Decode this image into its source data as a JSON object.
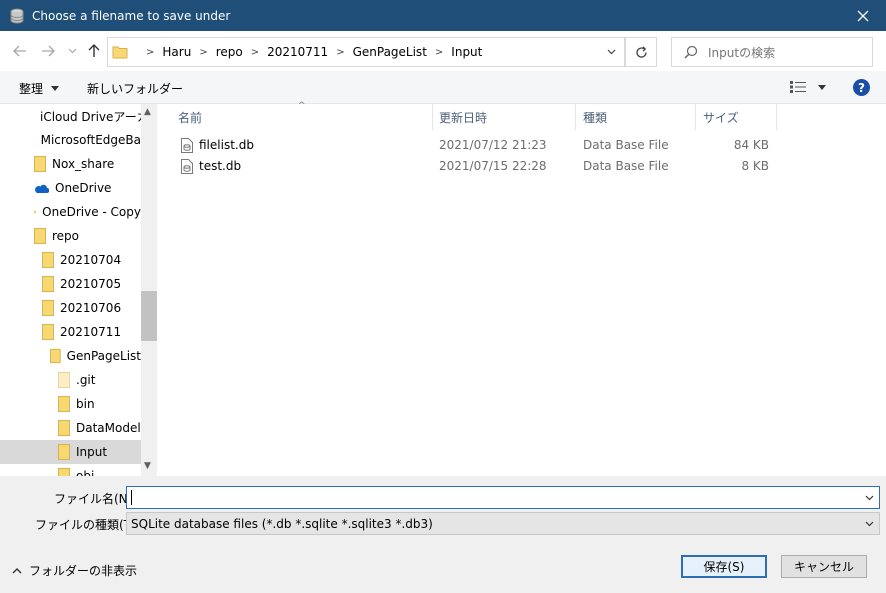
{
  "window": {
    "title": "Choose a filename to save under"
  },
  "address": {
    "crumbs": [
      "Haru",
      "repo",
      "20210711",
      "GenPageList",
      "Input"
    ]
  },
  "search": {
    "placeholder": "Inputの検索"
  },
  "toolbar": {
    "organize": "整理",
    "new_folder": "新しいフォルダー",
    "help": "?"
  },
  "nav": {
    "items": [
      {
        "label": "iCloud Driveアーカ",
        "indent": 0
      },
      {
        "label": "MicrosoftEdgeBa",
        "indent": 0
      },
      {
        "label": "Nox_share",
        "indent": 0
      },
      {
        "label": "OneDrive",
        "indent": 0
      },
      {
        "label": "OneDrive - Copy",
        "indent": 0
      },
      {
        "label": "repo",
        "indent": 0
      },
      {
        "label": "20210704",
        "indent": 1
      },
      {
        "label": "20210705",
        "indent": 1
      },
      {
        "label": "20210706",
        "indent": 1
      },
      {
        "label": "20210711",
        "indent": 1
      },
      {
        "label": "GenPageList",
        "indent": 2
      },
      {
        "label": ".git",
        "indent": 3
      },
      {
        "label": "bin",
        "indent": 3
      },
      {
        "label": "DataModel",
        "indent": 3
      },
      {
        "label": "Input",
        "indent": 3,
        "selected": true
      },
      {
        "label": "obj",
        "indent": 3
      }
    ]
  },
  "columns": {
    "name": "名前",
    "date": "更新日時",
    "type": "種類",
    "size": "サイズ"
  },
  "files": [
    {
      "name": "filelist.db",
      "date": "2021/07/12 21:23",
      "type": "Data Base File",
      "size": "84 KB"
    },
    {
      "name": "test.db",
      "date": "2021/07/15 22:28",
      "type": "Data Base File",
      "size": "8 KB"
    }
  ],
  "form": {
    "filename_label": "ファイル名(N):",
    "filename_value": "",
    "filetype_label": "ファイルの種類(T):",
    "filetype_value": "SQLite database files (*.db *.sqlite *.sqlite3 *.db3)"
  },
  "footer": {
    "hide_folders": "フォルダーの非表示",
    "save": "保存(S)",
    "cancel": "キャンセル"
  },
  "colors": {
    "titlebar": "#1f4e79",
    "folder": "#f8d775",
    "accent": "#2f6db5"
  }
}
